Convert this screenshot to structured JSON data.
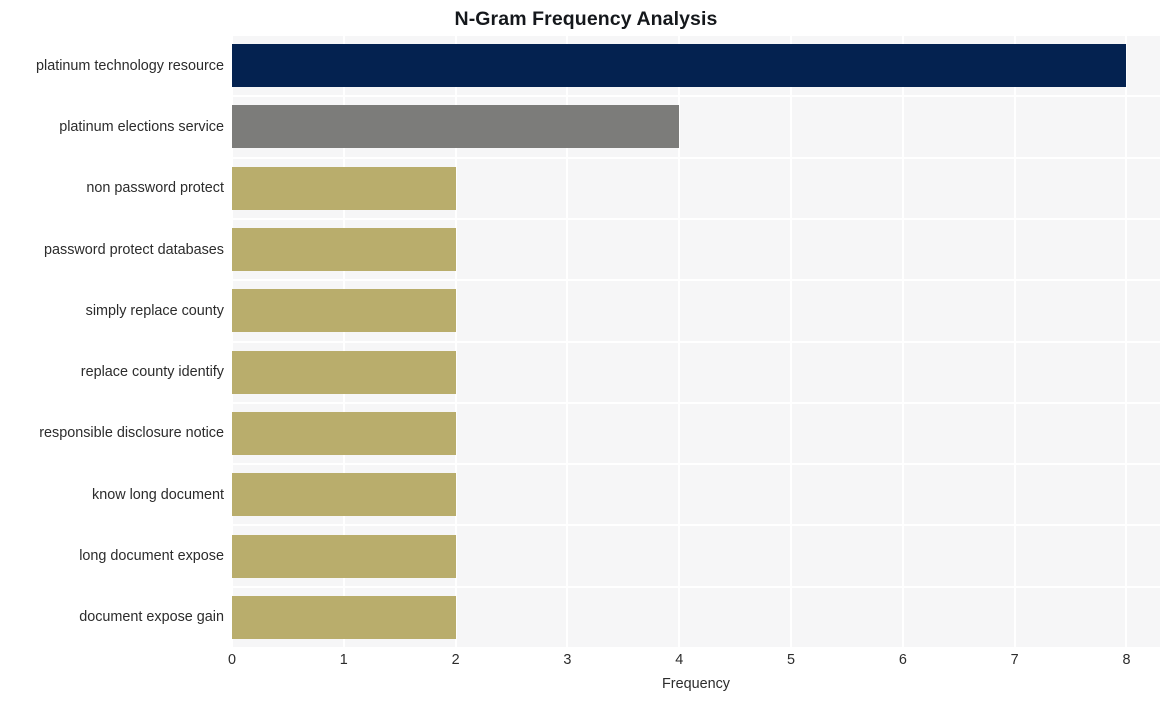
{
  "chart_data": {
    "type": "bar",
    "orientation": "horizontal",
    "title": "N-Gram Frequency Analysis",
    "xlabel": "Frequency",
    "ylabel": "",
    "xlim": [
      0,
      8.3
    ],
    "xticks": [
      0,
      1,
      2,
      3,
      4,
      5,
      6,
      7,
      8
    ],
    "xtick_labels": [
      "0",
      "1",
      "2",
      "3",
      "4",
      "5",
      "6",
      "7",
      "8"
    ],
    "grid": true,
    "grid_color": "#ffffff",
    "plot_background": "#f6f6f7",
    "figure_background": "#ffffff",
    "legend": null,
    "categories": [
      "platinum technology resource",
      "platinum elections service",
      "non password protect",
      "password protect databases",
      "simply replace county",
      "replace county identify",
      "responsible disclosure notice",
      "know long document",
      "long document expose",
      "document expose gain"
    ],
    "values": [
      8,
      4,
      2,
      2,
      2,
      2,
      2,
      2,
      2,
      2
    ],
    "bar_colors": [
      "#042250",
      "#7c7c7a",
      "#b9ad6c",
      "#b9ad6c",
      "#b9ad6c",
      "#b9ad6c",
      "#b9ad6c",
      "#b9ad6c",
      "#b9ad6c",
      "#b9ad6c"
    ],
    "bars": [
      {
        "label": "platinum technology resource",
        "value": 8,
        "color": "#042250"
      },
      {
        "label": "platinum elections service",
        "value": 4,
        "color": "#7c7c7a"
      },
      {
        "label": "non password protect",
        "value": 2,
        "color": "#b9ad6c"
      },
      {
        "label": "password protect databases",
        "value": 2,
        "color": "#b9ad6c"
      },
      {
        "label": "simply replace county",
        "value": 2,
        "color": "#b9ad6c"
      },
      {
        "label": "replace county identify",
        "value": 2,
        "color": "#b9ad6c"
      },
      {
        "label": "responsible disclosure notice",
        "value": 2,
        "color": "#b9ad6c"
      },
      {
        "label": "know long document",
        "value": 2,
        "color": "#b9ad6c"
      },
      {
        "label": "long document expose",
        "value": 2,
        "color": "#b9ad6c"
      },
      {
        "label": "document expose gain",
        "value": 2,
        "color": "#b9ad6c"
      }
    ]
  }
}
